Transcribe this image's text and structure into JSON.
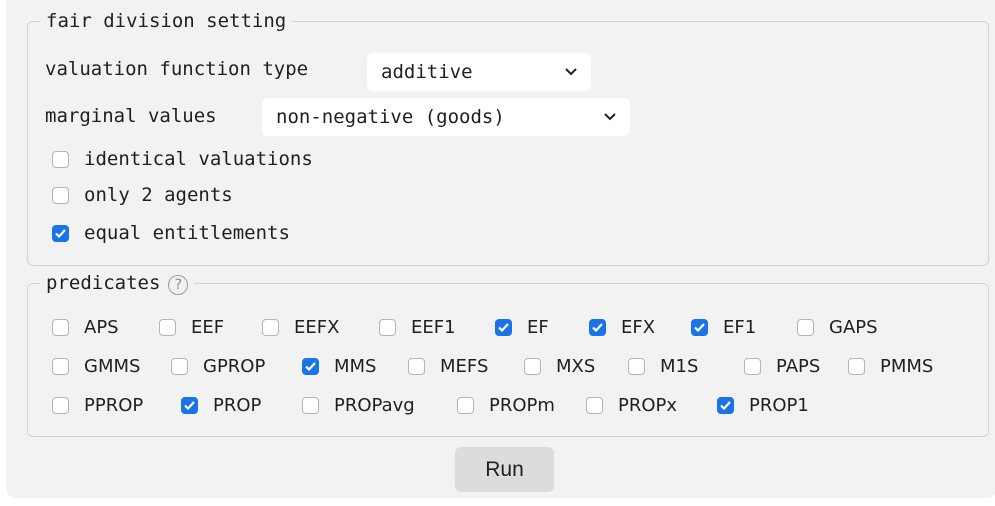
{
  "setting": {
    "legend": "fair division setting",
    "valuation_label": "valuation function type",
    "valuation_value": "additive",
    "marginal_label": "marginal values",
    "marginal_value": "non-negative (goods)",
    "options": [
      {
        "label": "identical valuations",
        "checked": false
      },
      {
        "label": "only 2 agents",
        "checked": false
      },
      {
        "label": "equal entitlements",
        "checked": true
      }
    ]
  },
  "predicates": {
    "legend": "predicates",
    "help_icon": "?",
    "rows": [
      [
        {
          "label": "APS",
          "checked": false
        },
        {
          "label": "EEF",
          "checked": false
        },
        {
          "label": "EEFX",
          "checked": false
        },
        {
          "label": "EEF1",
          "checked": false
        },
        {
          "label": "EF",
          "checked": true
        },
        {
          "label": "EFX",
          "checked": true
        },
        {
          "label": "EF1",
          "checked": true
        },
        {
          "label": "GAPS",
          "checked": false
        }
      ],
      [
        {
          "label": "GMMS",
          "checked": false
        },
        {
          "label": "GPROP",
          "checked": false
        },
        {
          "label": "MMS",
          "checked": true
        },
        {
          "label": "MEFS",
          "checked": false
        },
        {
          "label": "MXS",
          "checked": false
        },
        {
          "label": "M1S",
          "checked": false
        },
        {
          "label": "PAPS",
          "checked": false
        },
        {
          "label": "PMMS",
          "checked": false
        }
      ],
      [
        {
          "label": "PPROP",
          "checked": false
        },
        {
          "label": "PROP",
          "checked": true
        },
        {
          "label": "PROPavg",
          "checked": false
        },
        {
          "label": "PROPm",
          "checked": false
        },
        {
          "label": "PROPx",
          "checked": false
        },
        {
          "label": "PROP1",
          "checked": true
        }
      ]
    ]
  },
  "run_label": "Run",
  "colors": {
    "accent": "#1a73e8",
    "panel": "#f2f2f2",
    "border": "#d2d2d2",
    "button": "#dcdcdc"
  }
}
